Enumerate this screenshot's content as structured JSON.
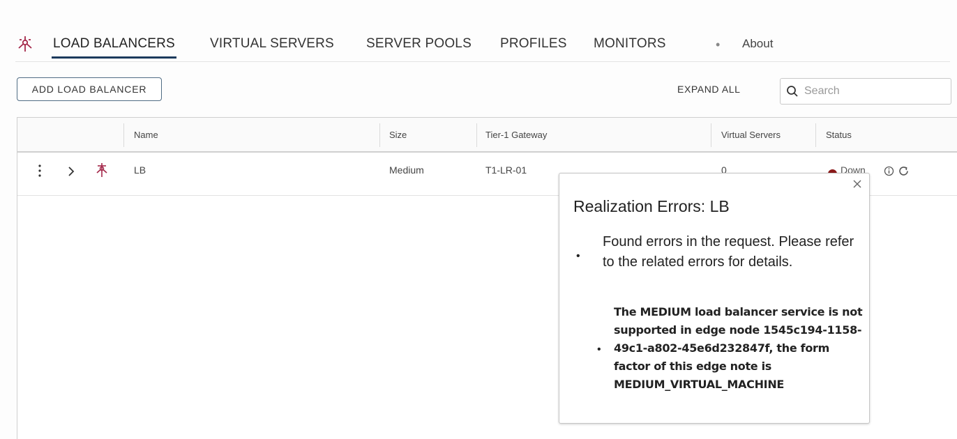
{
  "nav": {
    "tabs": [
      {
        "label": "LOAD BALANCERS",
        "active": true
      },
      {
        "label": "VIRTUAL SERVERS",
        "active": false
      },
      {
        "label": "SERVER POOLS",
        "active": false
      },
      {
        "label": "PROFILES",
        "active": false
      },
      {
        "label": "MONITORS",
        "active": false
      }
    ],
    "bullet": "•",
    "about": "About"
  },
  "toolbar": {
    "add_label": "ADD LOAD BALANCER",
    "expand_all": "EXPAND ALL",
    "search_placeholder": "Search"
  },
  "table": {
    "columns": [
      "Name",
      "Size",
      "Tier-1 Gateway",
      "Virtual Servers",
      "Status"
    ],
    "rows": [
      {
        "name": "LB",
        "size": "Medium",
        "tier1_gateway": "T1-LR-01",
        "virtual_servers": "0",
        "status": "Down",
        "status_color": "#8b1a1a"
      }
    ]
  },
  "popover": {
    "title": "Realization Errors: LB",
    "error_main": "Found errors in the request. Please refer to the related errors for details.",
    "error_detail": "The MEDIUM load balancer service is not supported in edge node 1545c194-1158-49c1-a802-45e6d232847f, the form factor of this edge note is MEDIUM_VIRTUAL_MACHINE",
    "bullet": "•"
  },
  "colors": {
    "accent": "#1b3a5c",
    "brand_icon": "#a4284a",
    "status_down": "#8b1a1a"
  },
  "icons": {
    "nav": "load-balancer-icon",
    "row": "load-balancer-icon",
    "search": "search-icon",
    "row_menu": "kebab-menu-icon",
    "expand": "chevron-right-icon",
    "info": "info-icon",
    "refresh": "refresh-icon",
    "close": "close-icon"
  }
}
